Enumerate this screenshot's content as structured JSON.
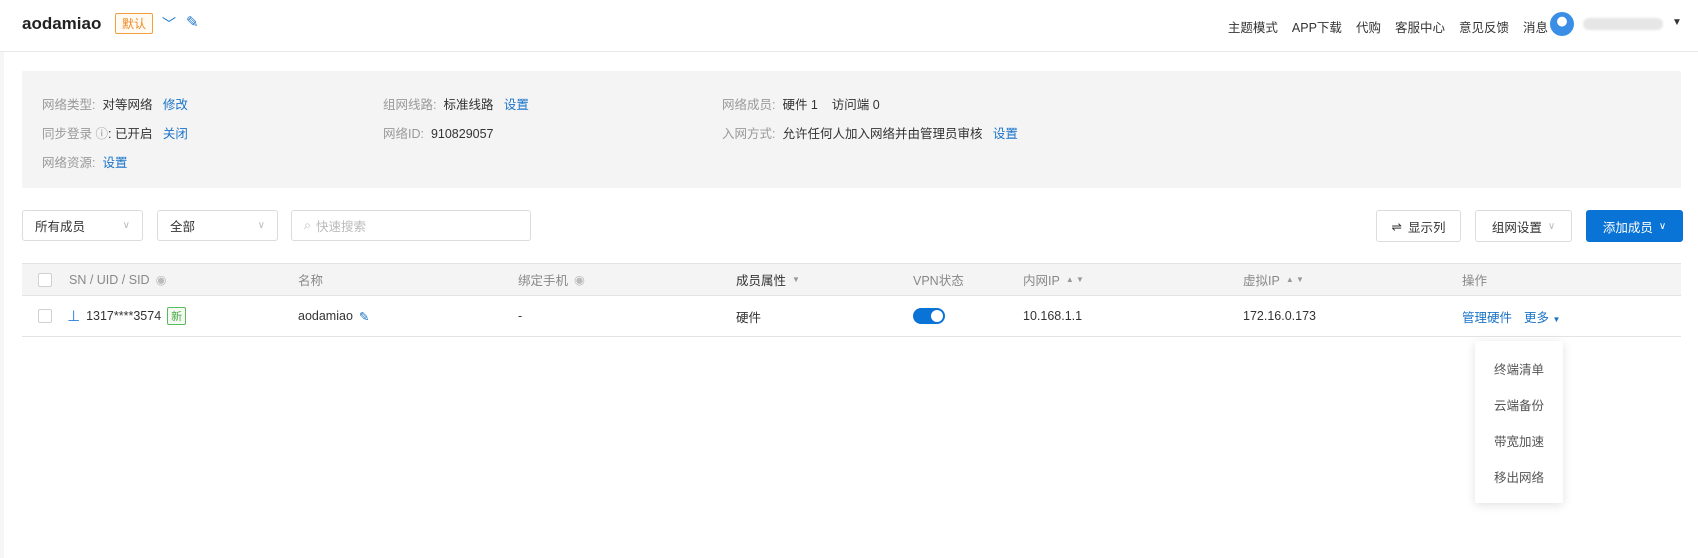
{
  "header": {
    "title": "aodamiao",
    "default_tag": "默认",
    "nav": [
      "主题模式",
      "APP下载",
      "代购",
      "客服中心",
      "意见反馈",
      "消息"
    ]
  },
  "info": {
    "net_type_label": "网络类型:",
    "net_type": "对等网络",
    "net_type_action": "修改",
    "sync_label": "同步登录",
    "sync_value": ": 已开启",
    "sync_action": "关闭",
    "resource_label": "网络资源:",
    "resource_action": "设置",
    "route_label": "组网线路:",
    "route_value": "标准线路",
    "route_action": "设置",
    "id_label": "网络ID:",
    "id_value": "910829057",
    "members_label": "网络成员:",
    "members_value": "硬件 1",
    "members_visitor": "访问端 0",
    "join_label": "入网方式:",
    "join_value": "允许任何人加入网络并由管理员审核",
    "join_action": "设置"
  },
  "filters": {
    "member_select": "所有成员",
    "type_select": "全部",
    "search_placeholder": "快速搜索"
  },
  "toolbar": {
    "columns": "显示列",
    "network_settings": "组网设置",
    "add_member": "添加成员"
  },
  "table": {
    "headers": [
      "SN / UID / SID",
      "名称",
      "绑定手机",
      "成员属性",
      "VPN状态",
      "内网IP",
      "虚拟IP",
      "操作"
    ],
    "rows": [
      {
        "sn": "1317****3574",
        "new_tag": "新",
        "name": "aodamiao",
        "phone": "-",
        "attr": "硬件",
        "vpn_on": true,
        "lan_ip": "10.168.1.1",
        "virtual_ip": "172.16.0.173",
        "action_manage": "管理硬件",
        "action_more": "更多"
      }
    ]
  },
  "more_menu": [
    "终端清单",
    "云端备份",
    "带宽加速",
    "移出网络"
  ]
}
